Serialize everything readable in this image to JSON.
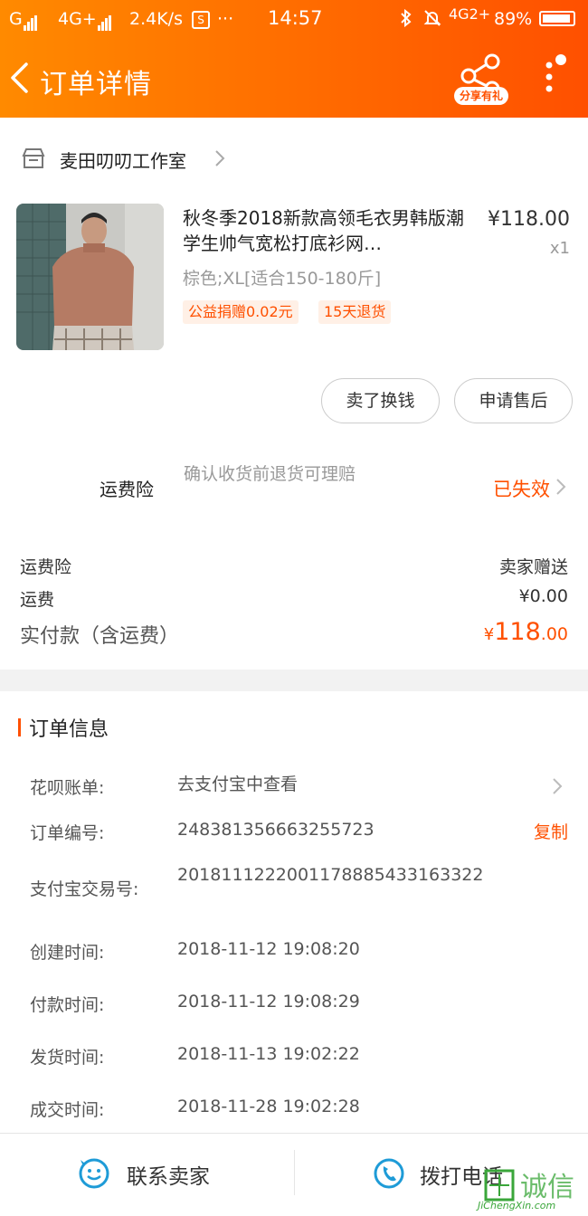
{
  "status_bar": {
    "carrier1": "G",
    "carrier2": "4G+",
    "speed": "2.4K/s",
    "dots": "···",
    "time": "14:57",
    "network": "4G2+",
    "battery": "89%"
  },
  "nav": {
    "title": "订单详情",
    "share_label": "分享有礼"
  },
  "shop": {
    "name": "麦田叨叨工作室"
  },
  "product": {
    "title": "秋冬季2018新款高领毛衣男韩版潮学生帅气宽松打底衫网…",
    "price": "¥118.00",
    "quantity": "x1",
    "spec": "棕色;XL[适合150-180斤]",
    "tags": [
      "公益捐赠0.02元",
      "15天退货"
    ]
  },
  "actions": {
    "sell_label": "卖了换钱",
    "after_sale_label": "申请售后"
  },
  "insurance": {
    "label": "运费险",
    "desc": "确认收货前退货可理赔",
    "status": "已失效"
  },
  "summary": {
    "rows": [
      {
        "label": "运费险",
        "value": "卖家赠送"
      },
      {
        "label": "运费",
        "value": "¥0.00"
      }
    ],
    "total_label": "实付款（含运费）",
    "total_symbol": "¥",
    "total_int": "118",
    "total_dec": ".00"
  },
  "order_info": {
    "title": "订单信息",
    "items": [
      {
        "key": "花呗账单:",
        "value": "去支付宝中查看"
      },
      {
        "key": "订单编号:",
        "value": "248381356663255723"
      },
      {
        "key": "支付宝交易号:",
        "value": "2018111222001178885433163322"
      },
      {
        "key": "创建时间:",
        "value": "2018-11-12 19:08:20"
      },
      {
        "key": "付款时间:",
        "value": "2018-11-12 19:08:29"
      },
      {
        "key": "发货时间:",
        "value": "2018-11-13 19:02:22"
      },
      {
        "key": "成交时间:",
        "value": "2018-11-28 19:02:28"
      }
    ],
    "copy_label": "复制"
  },
  "bottom_bar": {
    "contact_label": "联系卖家",
    "call_label": "拨打电话"
  },
  "watermark": {
    "text": "诚信",
    "url": "JiChengXin.com"
  },
  "colors": {
    "accent": "#ff5000",
    "header_start": "#ff8a00",
    "header_end": "#ff5000",
    "icon_blue": "#1e9bd7"
  },
  "icons": [
    "back-arrow-icon",
    "share-icon",
    "more-dots-icon",
    "shop-icon",
    "chevron-right-icon",
    "smile-chat-icon",
    "phone-icon"
  ]
}
